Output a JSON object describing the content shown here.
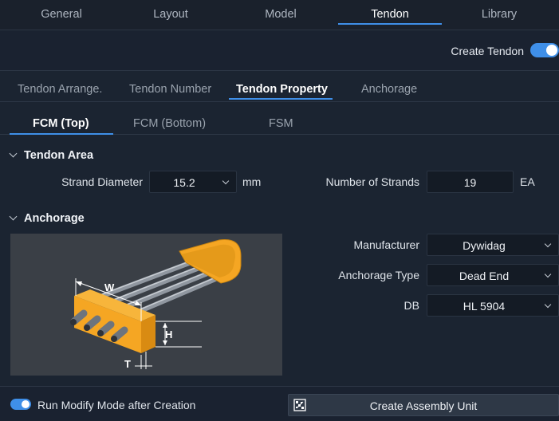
{
  "top_tabs": [
    "General",
    "Layout",
    "Model",
    "Tendon",
    "Library"
  ],
  "create_tendon": {
    "label": "Create Tendon",
    "enabled": true
  },
  "sub_tabs": [
    "Tendon Arrange.",
    "Tendon Number",
    "Tendon Property",
    "Anchorage"
  ],
  "third_tabs": [
    "FCM (Top)",
    "FCM (Bottom)",
    "FSM"
  ],
  "tendon_area": {
    "title": "Tendon Area",
    "strand_diameter": {
      "label": "Strand Diameter",
      "value": "15.2",
      "unit": "mm"
    },
    "number_of_strands": {
      "label": "Number of Strands",
      "value": "19",
      "unit": "EA"
    }
  },
  "anchorage": {
    "title": "Anchorage",
    "diagram_labels": {
      "w": "W",
      "h": "H",
      "t": "T"
    },
    "manufacturer": {
      "label": "Manufacturer",
      "value": "Dywidag"
    },
    "anchorage_type": {
      "label": "Anchorage Type",
      "value": "Dead End"
    },
    "db": {
      "label": "DB",
      "value": "HL 5904"
    }
  },
  "footer": {
    "modify_mode": {
      "label": "Run Modify Mode after Creation",
      "enabled": true
    },
    "create_button": "Create Assembly Unit"
  },
  "colors": {
    "accent": "#3f8fe8",
    "anchor": "#f5a623"
  }
}
